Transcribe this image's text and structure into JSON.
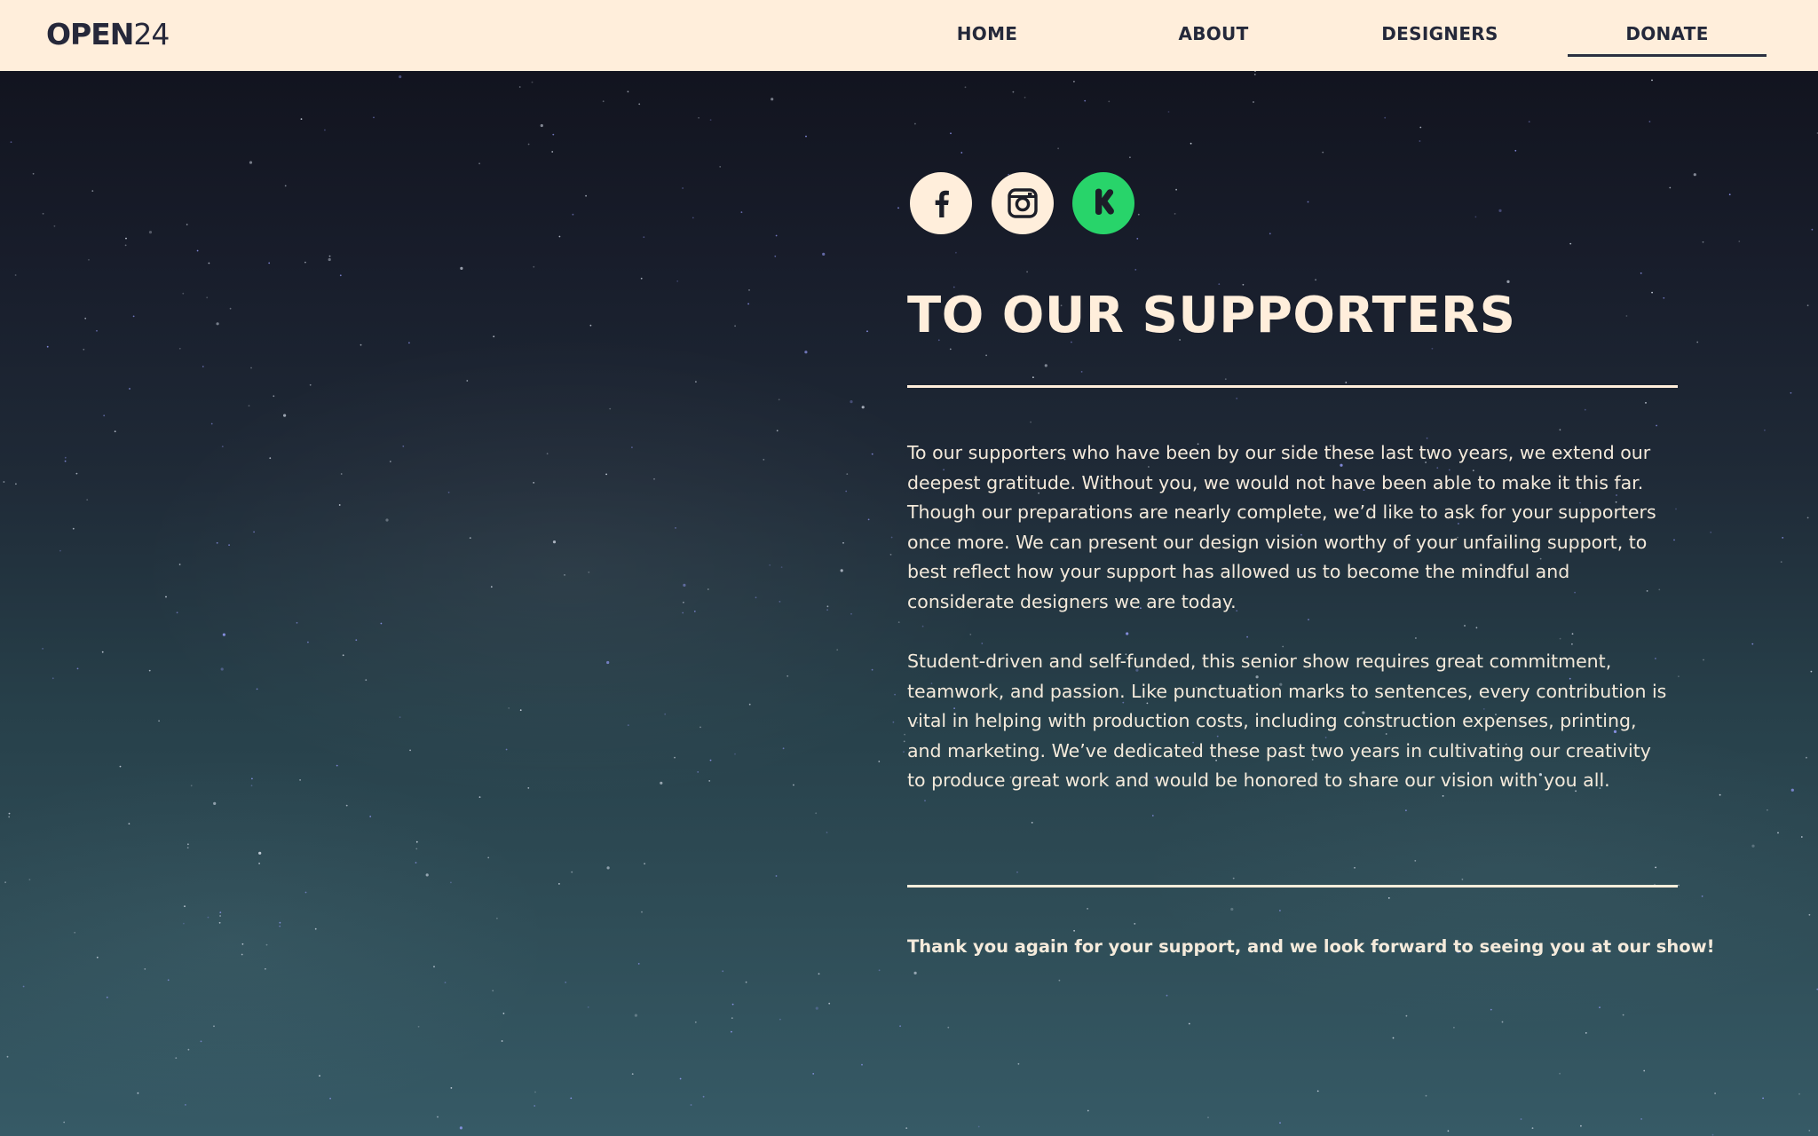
{
  "header": {
    "logo_bold": "OPEN",
    "logo_number": "24",
    "nav": [
      {
        "label": "HOME",
        "active": false
      },
      {
        "label": "ABOUT",
        "active": false
      },
      {
        "label": "DESIGNERS",
        "active": false
      },
      {
        "label": "DONATE",
        "active": true
      }
    ]
  },
  "social": [
    {
      "name": "facebook",
      "icon": "facebook-icon"
    },
    {
      "name": "instagram",
      "icon": "instagram-icon"
    },
    {
      "name": "kickstarter",
      "icon": "kickstarter-icon"
    }
  ],
  "main": {
    "title": "TO OUR SUPPORTERS",
    "paragraphs": [
      "To our supporters who have been by our side these last two years, we extend our deepest gratitude. Without you, we would not have been able to make it this far. Though our preparations are nearly complete, we’d like to ask for your supporters once more. We can present our design vision worthy of your unfailing support, to best reflect how your support has allowed us to become the mindful and considerate designers we are today.",
      "Student-driven and self-funded, this senior show requires great commitment, teamwork, and passion. Like punctuation marks to sentences, every contribution is vital in helping with production costs, including construction expenses, printing, and marketing. We’ve dedicated these past two years in cultivating our creativity to produce great work and would be honored to share our vision with you all."
    ],
    "closing": "Thank you again for your support, and we look forward to seeing you at our show!"
  },
  "colors": {
    "header_bg": "#ffeedb",
    "nav_text": "#24283a",
    "cream_text": "#ffeedb",
    "kickstarter_green": "#28d46a",
    "sky_top": "#12141f",
    "sky_bottom": "#365a66"
  }
}
